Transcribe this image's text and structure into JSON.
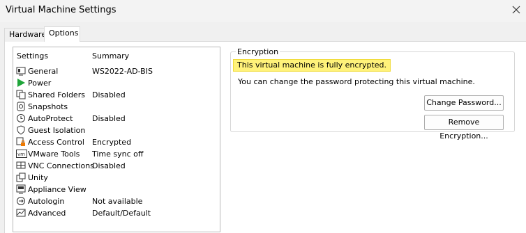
{
  "window": {
    "title": "Virtual Machine Settings"
  },
  "tabs": [
    {
      "label": "Hardware",
      "active": false
    },
    {
      "label": "Options",
      "active": true
    }
  ],
  "settings_list": {
    "headers": {
      "settings": "Settings",
      "summary": "Summary"
    },
    "items": [
      {
        "name": "General",
        "summary": "WS2022-AD-BIS",
        "icon": "general-icon"
      },
      {
        "name": "Power",
        "summary": "",
        "icon": "power-play-icon"
      },
      {
        "name": "Shared Folders",
        "summary": "Disabled",
        "icon": "shared-folders-icon"
      },
      {
        "name": "Snapshots",
        "summary": "",
        "icon": "snapshots-icon"
      },
      {
        "name": "AutoProtect",
        "summary": "Disabled",
        "icon": "autoprotect-icon"
      },
      {
        "name": "Guest Isolation",
        "summary": "",
        "icon": "guest-isolation-icon"
      },
      {
        "name": "Access Control",
        "summary": "Encrypted",
        "icon": "access-control-icon"
      },
      {
        "name": "VMware Tools",
        "summary": "Time sync off",
        "icon": "vmware-tools-icon"
      },
      {
        "name": "VNC Connections",
        "summary": "Disabled",
        "icon": "vnc-icon"
      },
      {
        "name": "Unity",
        "summary": "",
        "icon": "unity-icon"
      },
      {
        "name": "Appliance View",
        "summary": "",
        "icon": "appliance-view-icon"
      },
      {
        "name": "Autologin",
        "summary": "Not available",
        "icon": "autologin-icon"
      },
      {
        "name": "Advanced",
        "summary": "Default/Default",
        "icon": "advanced-icon"
      }
    ]
  },
  "encryption": {
    "group_label": "Encryption",
    "status": "This virtual machine is fully encrypted.",
    "description": "You can change the password protecting this virtual machine.",
    "change_password_label": "Change Password...",
    "remove_encryption_label": "Remove Encryption..."
  },
  "colors": {
    "status_highlight": "#fff27a",
    "power_green": "#1fa53a",
    "lock_orange": "#f07a00"
  }
}
